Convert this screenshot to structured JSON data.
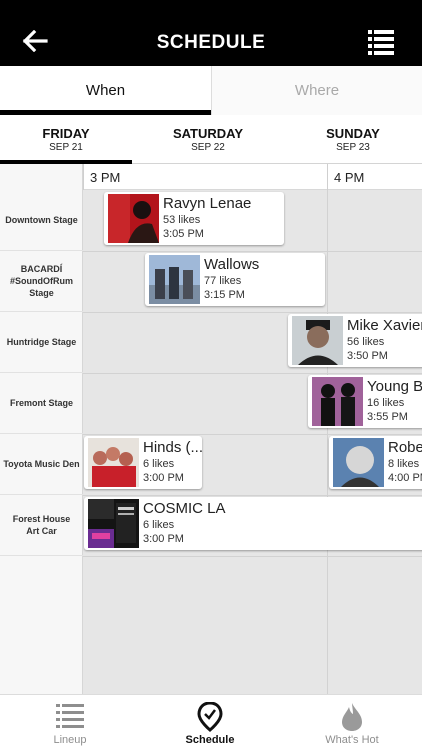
{
  "header": {
    "title": "SCHEDULE"
  },
  "view_toggle": {
    "when_label": "When",
    "where_label": "Where",
    "selected": "When"
  },
  "days": [
    {
      "name": "FRIDAY",
      "date": "SEP 21"
    },
    {
      "name": "SATURDAY",
      "date": "SEP 22"
    },
    {
      "name": "SUNDAY",
      "date": "SEP 23"
    }
  ],
  "selected_day": "FRIDAY",
  "timeline": {
    "ticks": [
      "3 PM",
      "4 PM"
    ]
  },
  "stages": [
    "Downtown Stage",
    "BACARDÍ\n#SoundOfRum\nStage",
    "Huntridge Stage",
    "Fremont Stage",
    "Toyota Music Den",
    "Forest House\nArt Car"
  ],
  "events": [
    {
      "artist": "Ravyn Lenae",
      "likes": "53 likes",
      "time": "3:05 PM",
      "stage": "Downtown Stage"
    },
    {
      "artist": "Wallows",
      "likes": "77 likes",
      "time": "3:15 PM",
      "stage": "BACARDÍ #SoundOfRum Stage"
    },
    {
      "artist": "Mike Xavier",
      "likes": "56 likes",
      "time": "3:50 PM",
      "stage": "Huntridge Stage"
    },
    {
      "artist": "Young Bo",
      "likes": "16 likes",
      "time": "3:55 PM",
      "stage": "Fremont Stage"
    },
    {
      "artist": "Hinds (...",
      "likes": "6 likes",
      "time": "3:00 PM",
      "stage": "Toyota Music Den"
    },
    {
      "artist": "Rober",
      "likes": "8 likes",
      "time": "4:00 PM",
      "stage": "Toyota Music Den"
    },
    {
      "artist": "COSMIC LA",
      "likes": "6 likes",
      "time": "3:00 PM",
      "stage": "Forest House Art Car"
    }
  ],
  "bottom_nav": [
    {
      "label": "Lineup",
      "icon": "list-icon"
    },
    {
      "label": "Schedule",
      "icon": "map-pin-icon"
    },
    {
      "label": "What's Hot",
      "icon": "flame-icon"
    }
  ],
  "colors": {
    "header_bg": "#000000",
    "grid_bg": "#e6e6e6",
    "inactive_text": "#a9a9a9"
  }
}
